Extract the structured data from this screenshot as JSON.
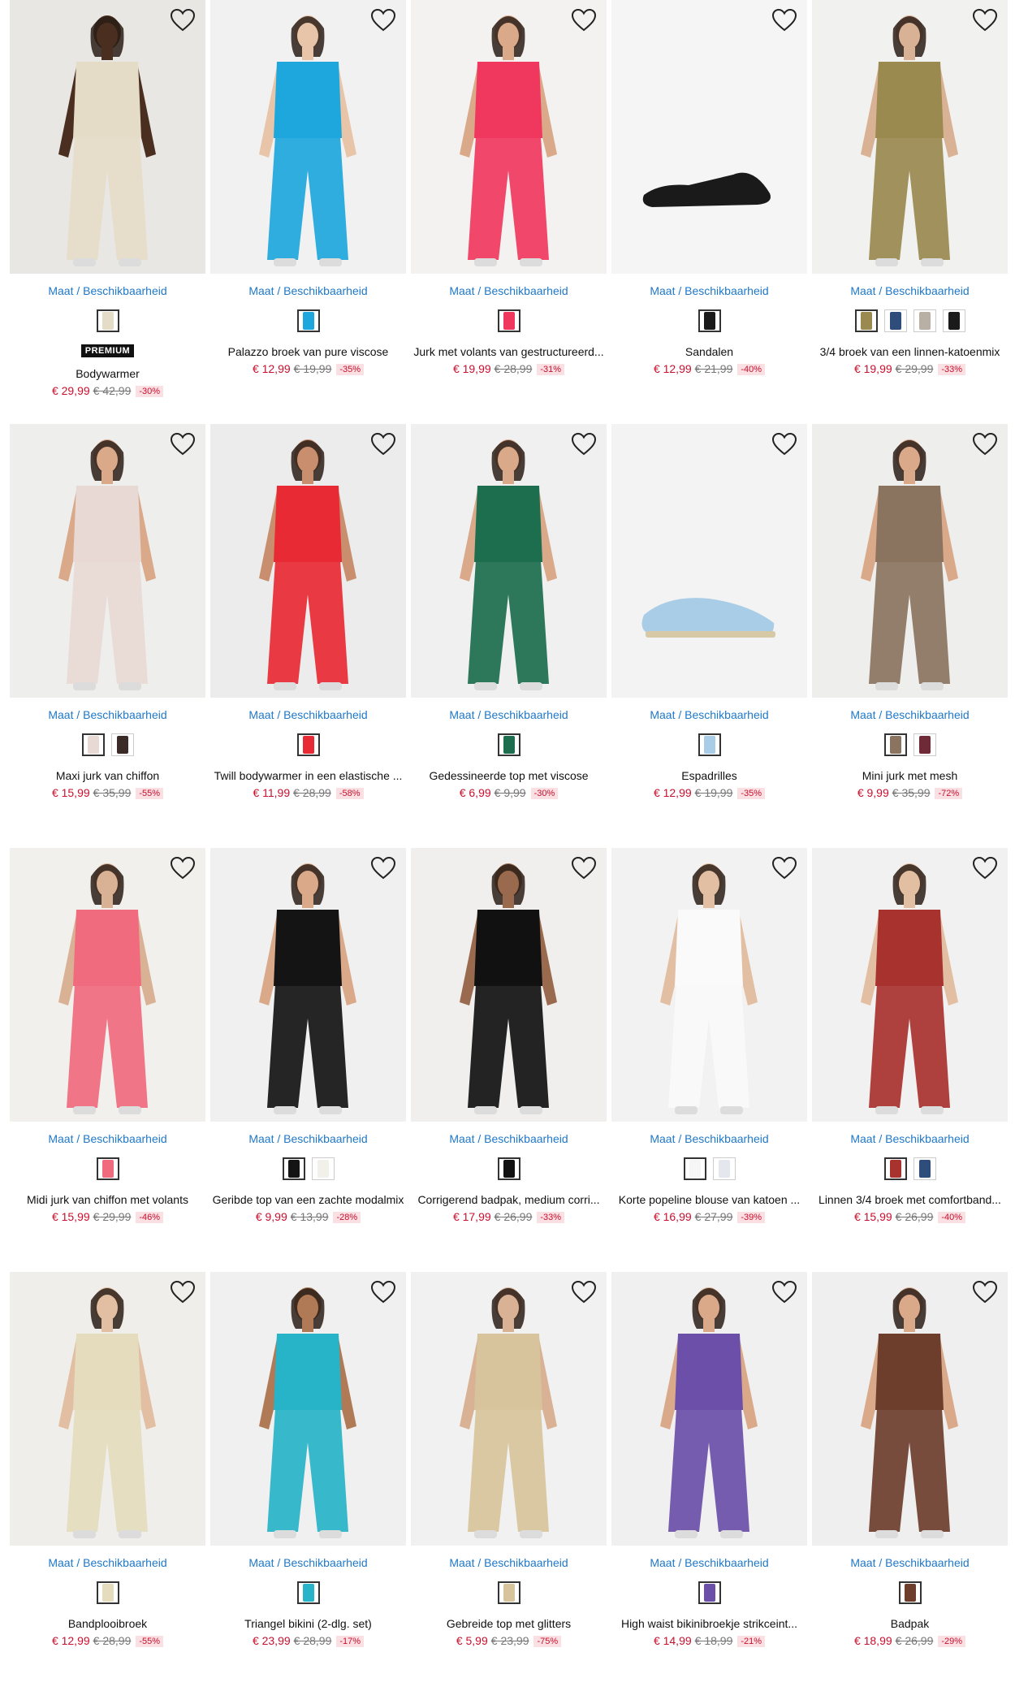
{
  "availability_label": "Maat / Beschikbaarheid",
  "premium_label": "PREMIUM",
  "colors": {
    "price": "#c8102e",
    "link": "#1f78c8",
    "discount_bg": "#fbe0e3"
  },
  "products": [
    {
      "name": "Bodywarmer",
      "price": "€ 29,99",
      "old_price": "€ 42,99",
      "discount": "-30%",
      "premium": true,
      "image_bg": "#e9e7e3",
      "garment": "#e5dcc8",
      "skin": "#4a2e20",
      "swatches": [
        "#e5dcc8"
      ]
    },
    {
      "name": "Palazzo broek van pure viscose",
      "price": "€ 12,99",
      "old_price": "€ 19,99",
      "discount": "-35%",
      "premium": false,
      "image_bg": "#f1f1f1",
      "garment": "#1ea7dd",
      "skin": "#e8c5a8",
      "swatches": [
        "#1ea7dd"
      ]
    },
    {
      "name": "Jurk met volants van gestructureerd...",
      "price": "€ 19,99",
      "old_price": "€ 28,99",
      "discount": "-31%",
      "premium": false,
      "image_bg": "#f3f2f0",
      "garment": "#f0385e",
      "skin": "#d9a98a",
      "swatches": [
        "#f0385e"
      ]
    },
    {
      "name": "Sandalen",
      "price": "€ 12,99",
      "old_price": "€ 21,99",
      "discount": "-40%",
      "premium": false,
      "image_bg": "#f5f5f5",
      "garment": "#1a1a1a",
      "skin": "#1a1a1a",
      "swatches": [
        "#1a1a1a"
      ]
    },
    {
      "name": "3/4 broek van een linnen-katoenmix",
      "price": "€ 19,99",
      "old_price": "€ 29,99",
      "discount": "-33%",
      "premium": false,
      "image_bg": "#f1f1ef",
      "garment": "#9a8a50",
      "skin": "#d9b194",
      "swatches": [
        "#9a8a50",
        "#2f4d7a",
        "#b8b0a4",
        "#1a1a1a"
      ]
    },
    {
      "name": "Maxi jurk van chiffon",
      "price": "€ 15,99",
      "old_price": "€ 35,99",
      "discount": "-55%",
      "premium": false,
      "image_bg": "#eeeeec",
      "garment": "#e8d9d4",
      "skin": "#d9a98a",
      "swatches": [
        "#e8d9d4",
        "#3a2a28"
      ]
    },
    {
      "name": "Twill bodywarmer in een elastische ...",
      "price": "€ 11,99",
      "old_price": "€ 28,99",
      "discount": "-58%",
      "premium": false,
      "image_bg": "#ececec",
      "garment": "#e82a35",
      "skin": "#c98e6e",
      "swatches": [
        "#e82a35"
      ]
    },
    {
      "name": "Gedessineerde top met viscose",
      "price": "€ 6,99",
      "old_price": "€ 9,99",
      "discount": "-30%",
      "premium": false,
      "image_bg": "#f0f0f0",
      "garment": "#1c6e4e",
      "skin": "#d9a98a",
      "swatches": [
        "#1c6e4e"
      ]
    },
    {
      "name": "Espadrilles",
      "price": "€ 12,99",
      "old_price": "€ 19,99",
      "discount": "-35%",
      "premium": false,
      "image_bg": "#f3f3f3",
      "garment": "#a9cde6",
      "skin": "#a9cde6",
      "swatches": [
        "#a9cde6"
      ]
    },
    {
      "name": "Mini jurk met mesh",
      "price": "€ 9,99",
      "old_price": "€ 35,99",
      "discount": "-72%",
      "premium": false,
      "image_bg": "#eeeeec",
      "garment": "#8a7460",
      "skin": "#d9a98a",
      "swatches": [
        "#8a7460",
        "#6e2a36"
      ]
    },
    {
      "name": "Midi jurk van chiffon met volants",
      "price": "€ 15,99",
      "old_price": "€ 29,99",
      "discount": "-46%",
      "premium": false,
      "image_bg": "#f2f0ec",
      "garment": "#f06b7e",
      "skin": "#d9b194",
      "swatches": [
        "#f06b7e"
      ]
    },
    {
      "name": "Geribde top van een zachte modalmix",
      "price": "€ 9,99",
      "old_price": "€ 13,99",
      "discount": "-28%",
      "premium": false,
      "image_bg": "#f0f0f0",
      "garment": "#141414",
      "skin": "#d9a98a",
      "swatches": [
        "#141414",
        "#f2f0ea"
      ]
    },
    {
      "name": "Corrigerend badpak, medium corri...",
      "price": "€ 17,99",
      "old_price": "€ 26,99",
      "discount": "-33%",
      "premium": false,
      "image_bg": "#f0efed",
      "garment": "#111111",
      "skin": "#9a6a4e",
      "swatches": [
        "#111111"
      ]
    },
    {
      "name": "Korte popeline blouse van katoen ...",
      "price": "€ 16,99",
      "old_price": "€ 27,99",
      "discount": "-39%",
      "premium": false,
      "image_bg": "#f2f2f2",
      "garment": "#fafafa",
      "skin": "#e2bfa2",
      "swatches": [
        "#f6f6f6",
        "#e4e8ee"
      ]
    },
    {
      "name": "Linnen 3/4 broek met comfortband...",
      "price": "€ 15,99",
      "old_price": "€ 26,99",
      "discount": "-40%",
      "premium": false,
      "image_bg": "#f1f1f1",
      "garment": "#a8322e",
      "skin": "#e2bfa2",
      "swatches": [
        "#a8322e",
        "#2f4d7a"
      ]
    },
    {
      "name": "Bandplooibroek",
      "price": "€ 12,99",
      "old_price": "€ 28,99",
      "discount": "-55%",
      "premium": false,
      "image_bg": "#efeeeb",
      "garment": "#e4dcbd",
      "skin": "#e2bfa2",
      "swatches": [
        "#e4dcbd"
      ]
    },
    {
      "name": "Triangel bikini (2-dlg. set)",
      "price": "€ 23,99",
      "old_price": "€ 28,99",
      "discount": "-17%",
      "premium": false,
      "image_bg": "#f0f0f0",
      "garment": "#27b3c8",
      "skin": "#b07a56",
      "swatches": [
        "#27b3c8"
      ]
    },
    {
      "name": "Gebreide top met glitters",
      "price": "€ 5,99",
      "old_price": "€ 23,99",
      "discount": "-75%",
      "premium": false,
      "image_bg": "#f1f1f1",
      "garment": "#d8c49c",
      "skin": "#d9b194",
      "swatches": [
        "#d8c49c"
      ]
    },
    {
      "name": "High waist bikinibroekje strikceint...",
      "price": "€ 14,99",
      "old_price": "€ 18,99",
      "discount": "-21%",
      "premium": false,
      "image_bg": "#f0f0f0",
      "garment": "#6b4fa8",
      "skin": "#d9a98a",
      "swatches": [
        "#6b4fa8"
      ]
    },
    {
      "name": "Badpak",
      "price": "€ 18,99",
      "old_price": "€ 26,99",
      "discount": "-29%",
      "premium": false,
      "image_bg": "#efefef",
      "garment": "#6e3e2c",
      "skin": "#d9a98a",
      "swatches": [
        "#6e3e2c"
      ]
    }
  ]
}
